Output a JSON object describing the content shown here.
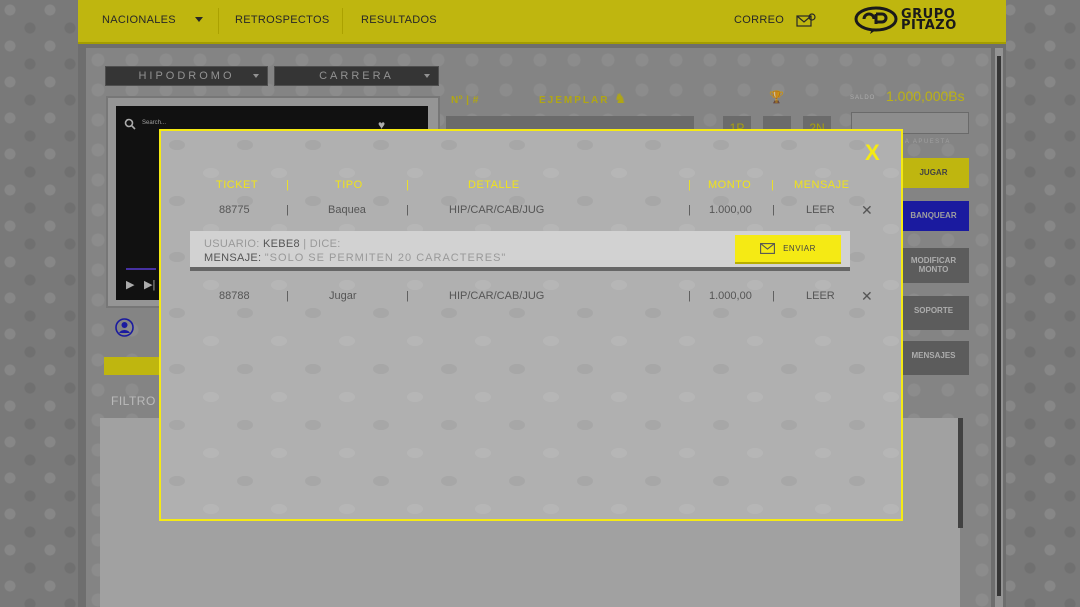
{
  "nav": {
    "items": [
      "NACIONALES",
      "RETROSPECTOS",
      "RESULTADOS"
    ],
    "correo": "CORREO",
    "logo_line1": "GRUPO",
    "logo_line2": "PITAZO"
  },
  "background": {
    "hipodromo": "HIPODROMO",
    "carrera": "CARRERA",
    "video_search": "Search...",
    "num_label": "Nº | #",
    "ejemplar_label": "EJEMPLAR",
    "saldo_label": "SALDO",
    "saldo_value": "1.000,000Bs",
    "apuesta_hint": "LA APUESTA",
    "btn_jugar": "JUGAR",
    "btn_banquear": "BANQUEAR",
    "btn_modificar_line1": "MODIFICAR",
    "btn_modificar_line2": "MONTO",
    "btn_soporte": "SOPORTE",
    "btn_mensajes": "MENSAJES",
    "pos_1p": "1P",
    "pos_2n": "2N",
    "filtro": "FILTRO"
  },
  "modal": {
    "headers": [
      "TICKET",
      "TIPO",
      "DETALLE",
      "MONTO",
      "MENSAJE"
    ],
    "rows": [
      {
        "ticket": "88775",
        "tipo": "Baquea",
        "detalle": "HIP/CAR/CAB/JUG",
        "monto": "1.000,00",
        "mensaje": "LEER"
      },
      {
        "ticket": "88788",
        "tipo": "Jugar",
        "detalle": "HIP/CAR/CAB/JUG",
        "monto": "1.000,00",
        "mensaje": "LEER"
      }
    ],
    "message": {
      "usuario_label": "USUARIO:",
      "usuario_value": "KEBE8",
      "dice_label": "DICE:",
      "mensaje_label": "MENSAJE:",
      "mensaje_placeholder": "\"SOLO SE PERMITEN 20 CARACTERES\"",
      "send_label": "ENVIAR"
    },
    "close_glyph": "X"
  },
  "colors": {
    "accent": "#f5ea14",
    "blue": "#2222cc"
  }
}
